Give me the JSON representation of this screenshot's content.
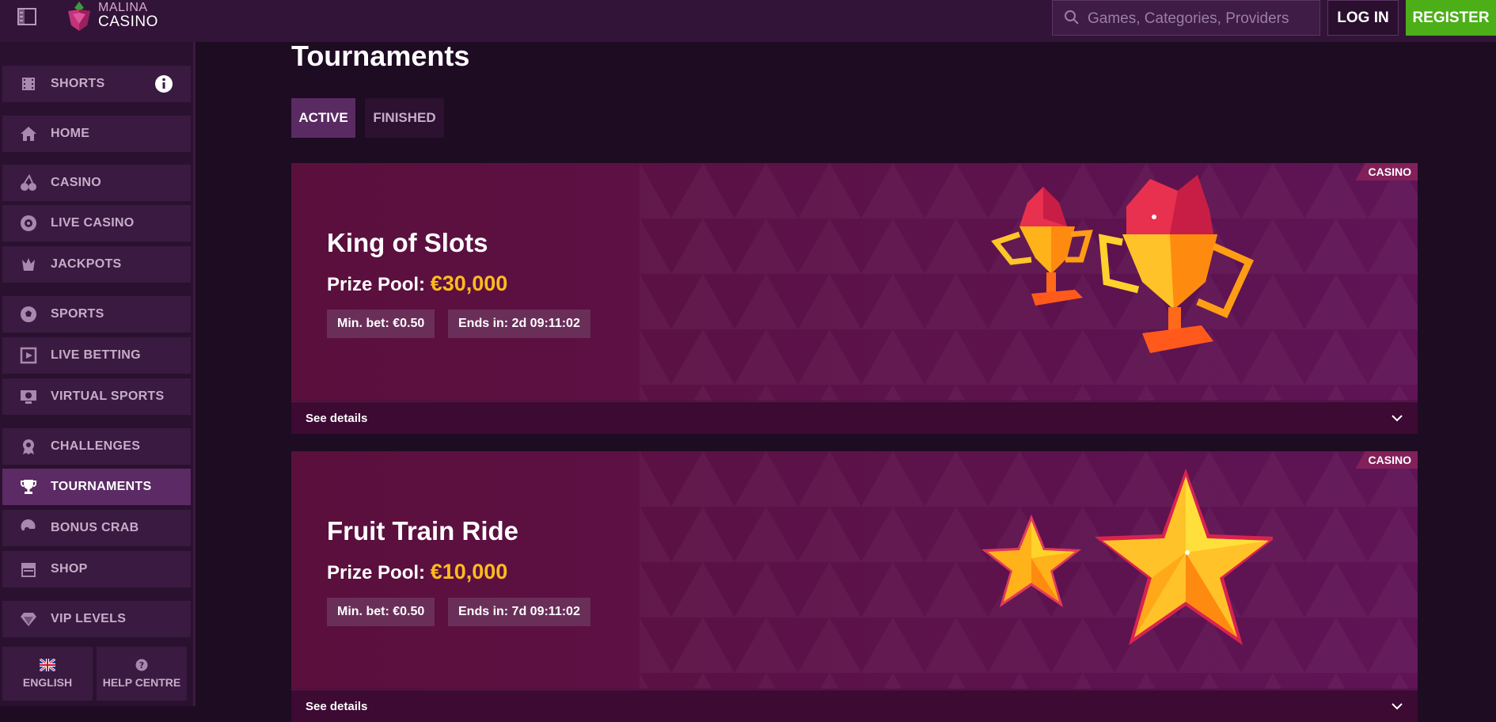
{
  "header": {
    "logo_line1": "MALINA",
    "logo_line2": "CASINO",
    "search_placeholder": "Games, Categories, Providers",
    "login_label": "LOG IN",
    "register_label": "REGISTER",
    "register_color": "#4caf18"
  },
  "sidebar": {
    "items": [
      {
        "label": "SHORTS",
        "icon": "film-icon"
      },
      {
        "label": "HOME",
        "icon": "home-icon"
      },
      {
        "label": "CASINO",
        "icon": "cherries-icon"
      },
      {
        "label": "LIVE CASINO",
        "icon": "roulette-icon"
      },
      {
        "label": "JACKPOTS",
        "icon": "crown-icon"
      },
      {
        "label": "SPORTS",
        "icon": "soccer-ball-icon"
      },
      {
        "label": "LIVE BETTING",
        "icon": "live-screen-icon"
      },
      {
        "label": "VIRTUAL SPORTS",
        "icon": "monitor-ball-icon"
      },
      {
        "label": "CHALLENGES",
        "icon": "medal-icon"
      },
      {
        "label": "TOURNAMENTS",
        "icon": "trophy-icon",
        "active": true
      },
      {
        "label": "BONUS CRAB",
        "icon": "claw-icon"
      },
      {
        "label": "SHOP",
        "icon": "store-icon"
      },
      {
        "label": "VIP LEVELS",
        "icon": "diamond-icon"
      }
    ],
    "language_label": "ENGLISH",
    "help_label": "HELP CENTRE"
  },
  "main": {
    "title": "Tournaments",
    "tabs": [
      {
        "label": "ACTIVE",
        "active": true
      },
      {
        "label": "FINISHED",
        "active": false
      }
    ],
    "tournaments": [
      {
        "badge": "CASINO",
        "name": "King of Slots",
        "prize_label": "Prize Pool:",
        "prize_amount": "€30,000",
        "min_bet": "Min. bet: €0.50",
        "ends_in": "Ends in: 2d 09:11:02",
        "details_label": "See details",
        "art": "trophies-icon"
      },
      {
        "badge": "CASINO",
        "name": "Fruit Train Ride",
        "prize_label": "Prize Pool:",
        "prize_amount": "€10,000",
        "min_bet": "Min. bet: €0.50",
        "ends_in": "Ends in: 7d 09:11:02",
        "details_label": "See details",
        "art": "stars-icon"
      }
    ]
  },
  "colors": {
    "background": "#1e0c22",
    "sidebar": "#2b1130",
    "card": "#46103f",
    "prize_accent": "#ffbb1f"
  }
}
